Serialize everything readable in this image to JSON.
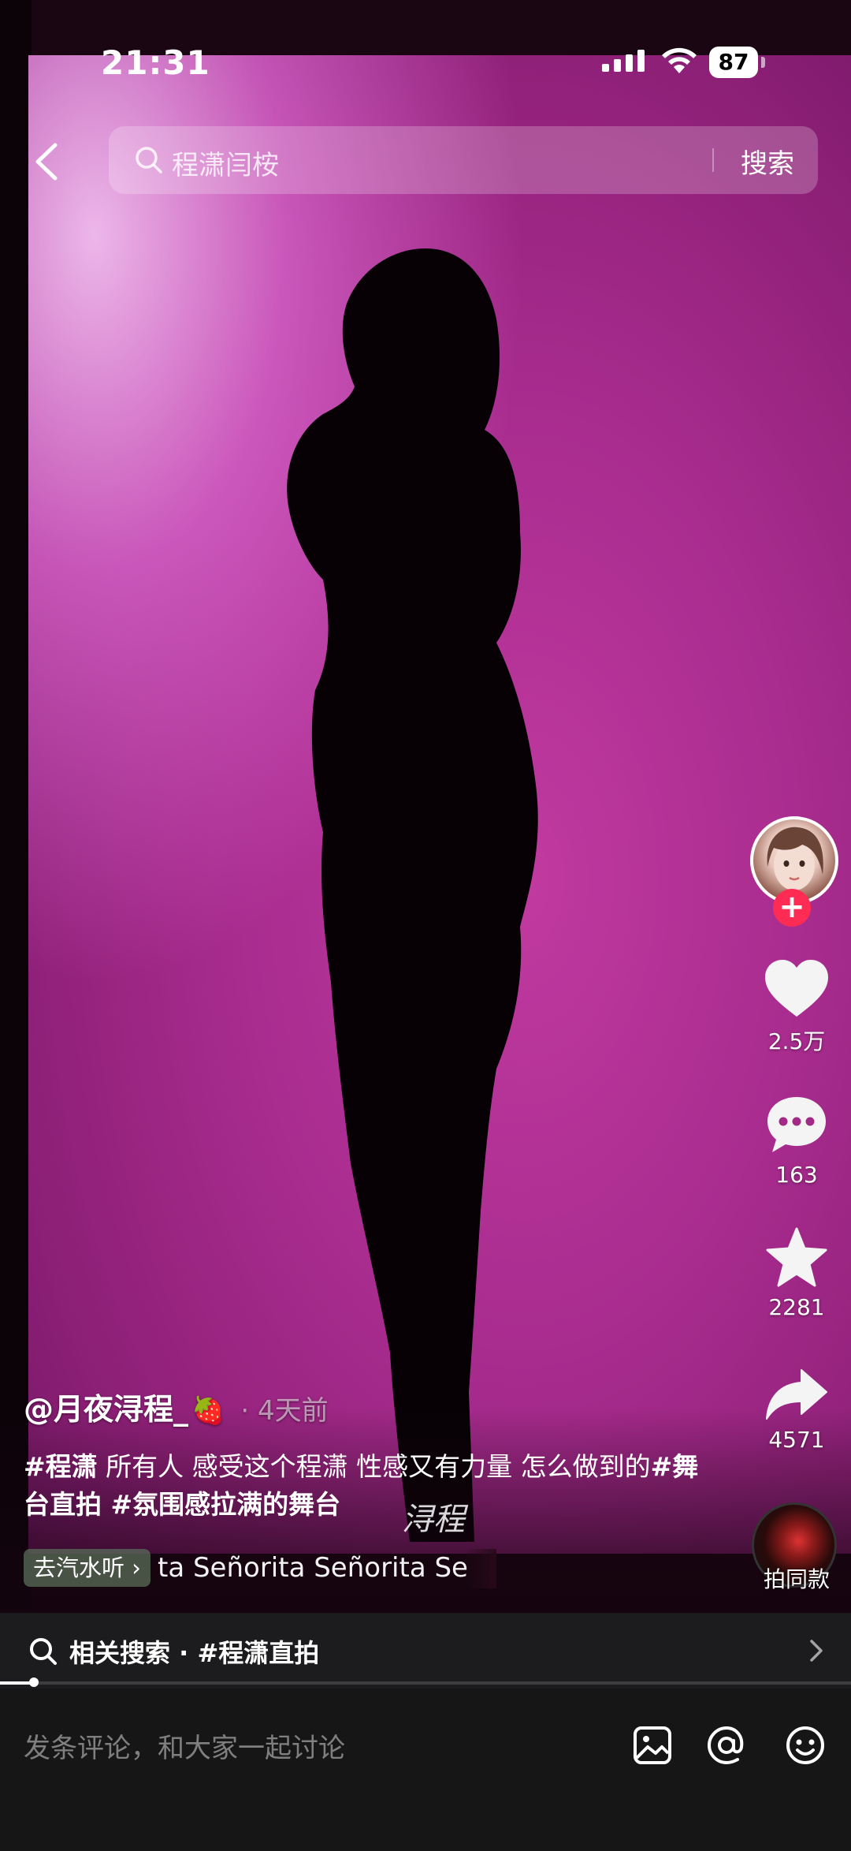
{
  "status_bar": {
    "time": "21:31",
    "battery": "87"
  },
  "search": {
    "query": "程潇闫桉",
    "button_label": "搜索"
  },
  "actions": {
    "like_count": "2.5万",
    "comment_count": "163",
    "favorite_count": "2281",
    "share_count": "4571",
    "remix_label": "拍同款"
  },
  "post": {
    "author": "@月夜浔程_",
    "author_emoji": "🍓",
    "time_ago": "· 4天前",
    "caption_tag1": "#程潇",
    "caption_text1": " 所有人 感受这个程潇 性感又有力量 怎么做到的",
    "caption_tag2": "#舞台直拍",
    "caption_tag3": " #氛围感拉满的舞台",
    "watermark": "浔程",
    "music_chip": "去汽水听",
    "music_title": "ta  Señorita  Señorita  Se"
  },
  "related": {
    "label": "相关搜索 · #程潇直拍"
  },
  "progress": {
    "fraction": 0.04
  },
  "comment": {
    "placeholder": "发条评论，和大家一起讨论"
  },
  "icons": {
    "back": "chevron-left-icon",
    "search": "search-icon",
    "like": "heart-icon",
    "comment": "comment-bubble-icon",
    "favorite": "star-icon",
    "share": "share-arrow-icon",
    "image": "image-icon",
    "mention": "at-icon",
    "emoji": "smiley-icon"
  },
  "colors": {
    "accent": "#fe2c55",
    "background_magenta": "#a92c8f"
  }
}
